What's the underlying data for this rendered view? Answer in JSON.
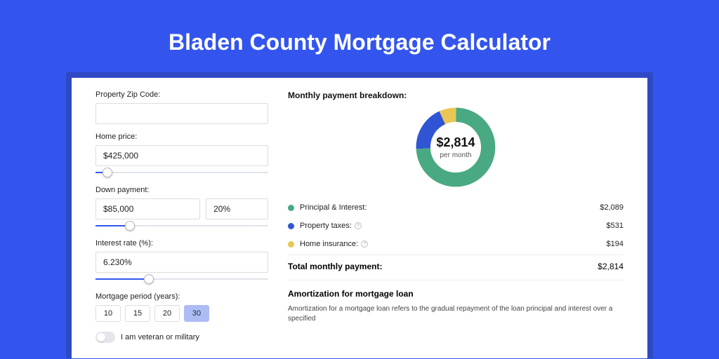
{
  "title": "Bladen County Mortgage Calculator",
  "form": {
    "zip_label": "Property Zip Code:",
    "zip_value": "",
    "home_price_label": "Home price:",
    "home_price_value": "$425,000",
    "home_price_slider_pct": 7,
    "down_payment_label": "Down payment:",
    "down_payment_value": "$85,000",
    "down_payment_pct_value": "20%",
    "down_payment_slider_pct": 20,
    "interest_label": "Interest rate (%):",
    "interest_value": "6.230%",
    "interest_slider_pct": 31,
    "period_label": "Mortgage period (years):",
    "period_options": [
      "10",
      "15",
      "20",
      "30"
    ],
    "period_selected": "30",
    "veteran_label": "I am veteran or military"
  },
  "breakdown": {
    "title": "Monthly payment breakdown:",
    "center_amount": "$2,814",
    "center_sub": "per month",
    "items": [
      {
        "label": "Principal & Interest:",
        "value": "$2,089",
        "color": "#49a983",
        "has_info": false
      },
      {
        "label": "Property taxes:",
        "value": "$531",
        "color": "#2f55d4",
        "has_info": true
      },
      {
        "label": "Home insurance:",
        "value": "$194",
        "color": "#e9c755",
        "has_info": true
      }
    ],
    "total_label": "Total monthly payment:",
    "total_value": "$2,814"
  },
  "chart_data": {
    "type": "pie",
    "title": "Monthly payment breakdown",
    "series": [
      {
        "name": "Principal & Interest",
        "value": 2089,
        "color": "#49a983"
      },
      {
        "name": "Property taxes",
        "value": 531,
        "color": "#2f55d4"
      },
      {
        "name": "Home insurance",
        "value": 194,
        "color": "#e9c755"
      }
    ],
    "total": 2814
  },
  "amort": {
    "title": "Amortization for mortgage loan",
    "body": "Amortization for a mortgage loan refers to the gradual repayment of the loan principal and interest over a specified"
  }
}
